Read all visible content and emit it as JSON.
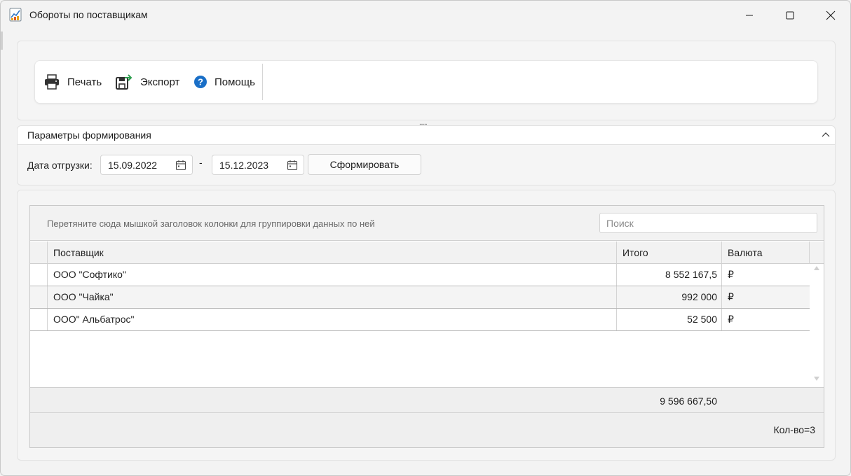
{
  "window": {
    "title": "Обороты по поставщикам",
    "controls": {
      "minimize_icon": "minimize-icon",
      "maximize_icon": "maximize-icon",
      "close_icon": "close-icon"
    }
  },
  "toolbar": {
    "print_label": "Печать",
    "export_label": "Экспорт",
    "help_label": "Помощь",
    "help_color": "#1a6fc7",
    "export_arrow_color": "#2e9e4f"
  },
  "params": {
    "title": "Параметры формирования",
    "date_label": "Дата отгрузки:",
    "date_from": "15.09.2022",
    "date_separator": "-",
    "date_to": "15.12.2023",
    "generate_button": "Сформировать"
  },
  "grid": {
    "group_hint": "Перетяните сюда мышкой заголовок колонки для группировки данных по ней",
    "search_placeholder": "Поиск",
    "columns": {
      "supplier": "Поставщик",
      "total": "Итого",
      "currency": "Валюта"
    },
    "rows": [
      {
        "supplier": "ООО \"Софтико\"",
        "total": "8 552 167,5",
        "currency": "₽"
      },
      {
        "supplier": "ООО \"Чайка\"",
        "total": "992 000",
        "currency": "₽"
      },
      {
        "supplier": "ООО\" Альбатрос\"",
        "total": "52 500",
        "currency": "₽"
      }
    ],
    "summary_total": "9 596 667,50",
    "count_label": "Кол-во=3"
  }
}
